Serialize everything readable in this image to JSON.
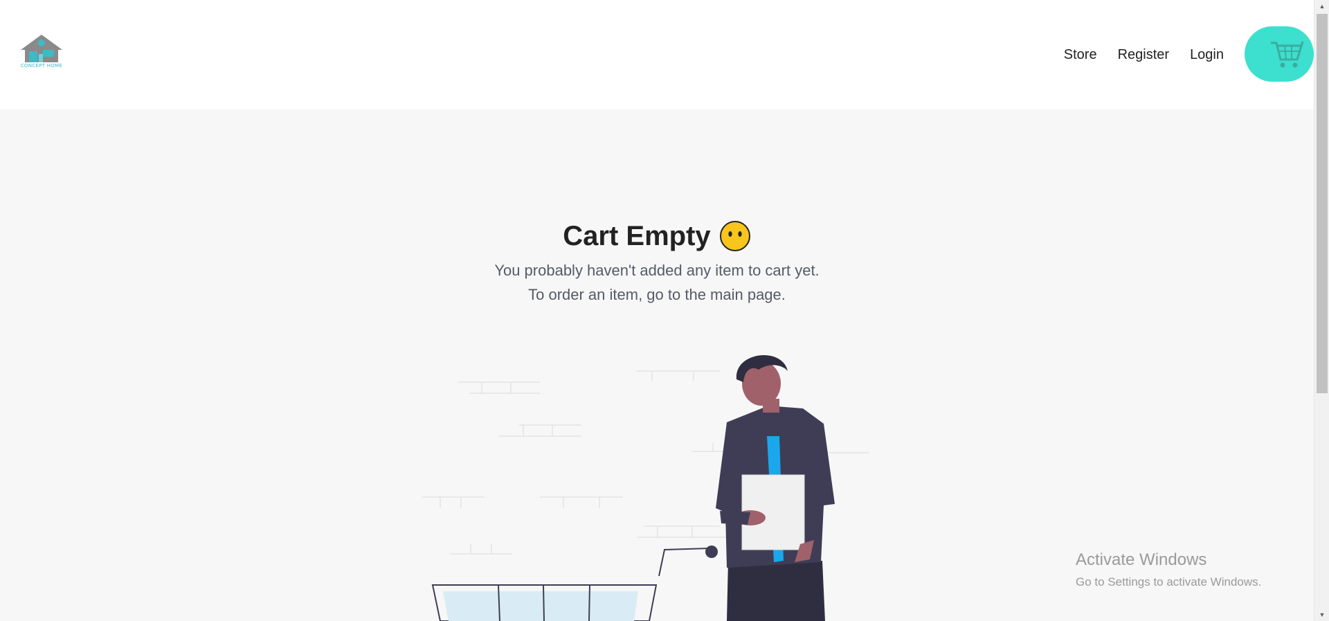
{
  "header": {
    "logo_text": "CONCEPT HOME",
    "nav": {
      "store": "Store",
      "register": "Register",
      "login": "Login"
    },
    "cart_icon": "shopping-cart-icon",
    "accent_color": "#3ddfcf"
  },
  "main": {
    "title": "Cart Empty",
    "emoji_icon": "neutral-face-icon",
    "line1": "You probably haven't added any item to cart yet.",
    "line2": "To order an item, go to the main page."
  },
  "watermark": {
    "title": "Activate Windows",
    "subtitle": "Go to Settings to activate Windows."
  }
}
